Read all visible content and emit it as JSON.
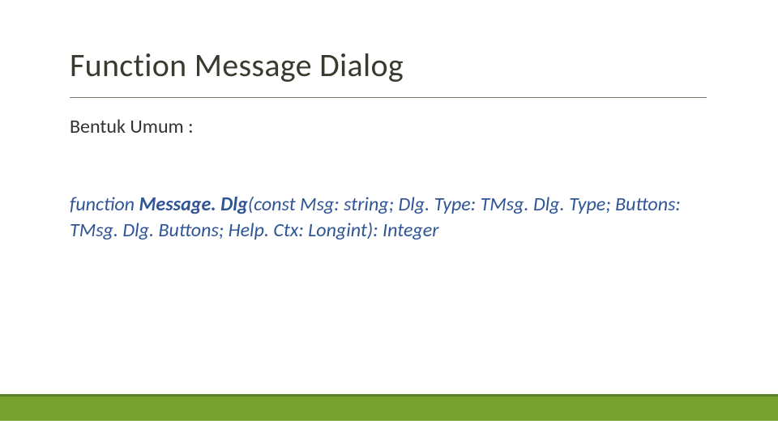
{
  "slide": {
    "title": "Function Message Dialog",
    "subtitle": "Bentuk Umum :",
    "signature": {
      "prefix": "function ",
      "bold": "Message. Dlg",
      "rest": "(const Msg: string; Dlg. Type: TMsg. Dlg. Type; Buttons: TMsg. Dlg. Buttons; Help. Ctx: Longint): Integer"
    }
  },
  "colors": {
    "accent": "#76a12e",
    "accent_dark": "#5d7f23",
    "code": "#2f5596"
  }
}
